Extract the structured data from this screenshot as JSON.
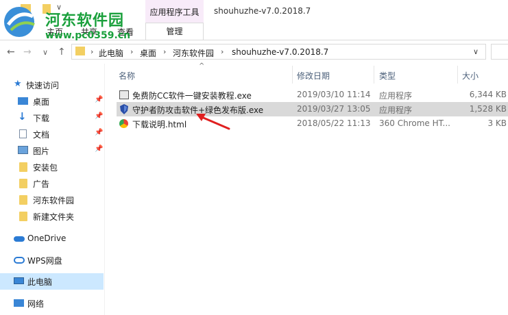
{
  "window": {
    "title": "shouhuzhe-v7.0.2018.7",
    "context_tab_group": "应用程序工具",
    "context_tab": "管理"
  },
  "ribbon": {
    "tabs": [
      "主页",
      "共享",
      "查看"
    ]
  },
  "watermark": {
    "name": "河东软件园",
    "url": "www.pc0359.cn"
  },
  "nav": {
    "back": "←",
    "forward": "→",
    "dropdown": "∨",
    "up": "↑",
    "breadcrumb": [
      "此电脑",
      "桌面",
      "河东软件园",
      "shouhuzhe-v7.0.2018.7"
    ],
    "separator": "›"
  },
  "sidebar": {
    "items": [
      {
        "label": "快速访问",
        "icon": "star-icon"
      },
      {
        "label": "桌面",
        "icon": "desktop-icon",
        "pinned": true
      },
      {
        "label": "下载",
        "icon": "download-icon",
        "pinned": true
      },
      {
        "label": "文档",
        "icon": "document-icon",
        "pinned": true
      },
      {
        "label": "图片",
        "icon": "picture-icon",
        "pinned": true
      },
      {
        "label": "安装包",
        "icon": "folder-icon"
      },
      {
        "label": "广告",
        "icon": "folder-icon"
      },
      {
        "label": "河东软件园",
        "icon": "folder-icon"
      },
      {
        "label": "新建文件夹",
        "icon": "folder-icon"
      },
      {
        "label": "OneDrive",
        "icon": "cloud-icon"
      },
      {
        "label": "WPS网盘",
        "icon": "wps-cloud-icon"
      },
      {
        "label": "此电脑",
        "icon": "computer-icon",
        "selected": true
      },
      {
        "label": "网络",
        "icon": "network-icon"
      }
    ],
    "pin_glyph": "📌"
  },
  "files": {
    "columns": [
      "名称",
      "修改日期",
      "类型",
      "大小"
    ],
    "sort_indicator": "^",
    "rows": [
      {
        "name": "免费防CC软件一键安装教程.exe",
        "modified": "2019/03/10 11:14",
        "type": "应用程序",
        "size": "6,344 KB",
        "icon": "exe-icon"
      },
      {
        "name": "守护者防攻击软件+绿色发布版.exe",
        "modified": "2019/03/27 13:05",
        "type": "应用程序",
        "size": "1,528 KB",
        "icon": "shield-exe-icon",
        "selected": true
      },
      {
        "name": "下载说明.html",
        "modified": "2018/05/22 11:13",
        "type": "360 Chrome HT...",
        "size": "3 KB",
        "icon": "html-icon"
      }
    ]
  },
  "colors": {
    "selection": "#cce8ff",
    "row_highlight": "#d9d9d9",
    "context_tab_bg": "#f8ebf9",
    "arrow": "#e02020",
    "folder": "#f3cf62",
    "watermark": "#1aa03c"
  }
}
